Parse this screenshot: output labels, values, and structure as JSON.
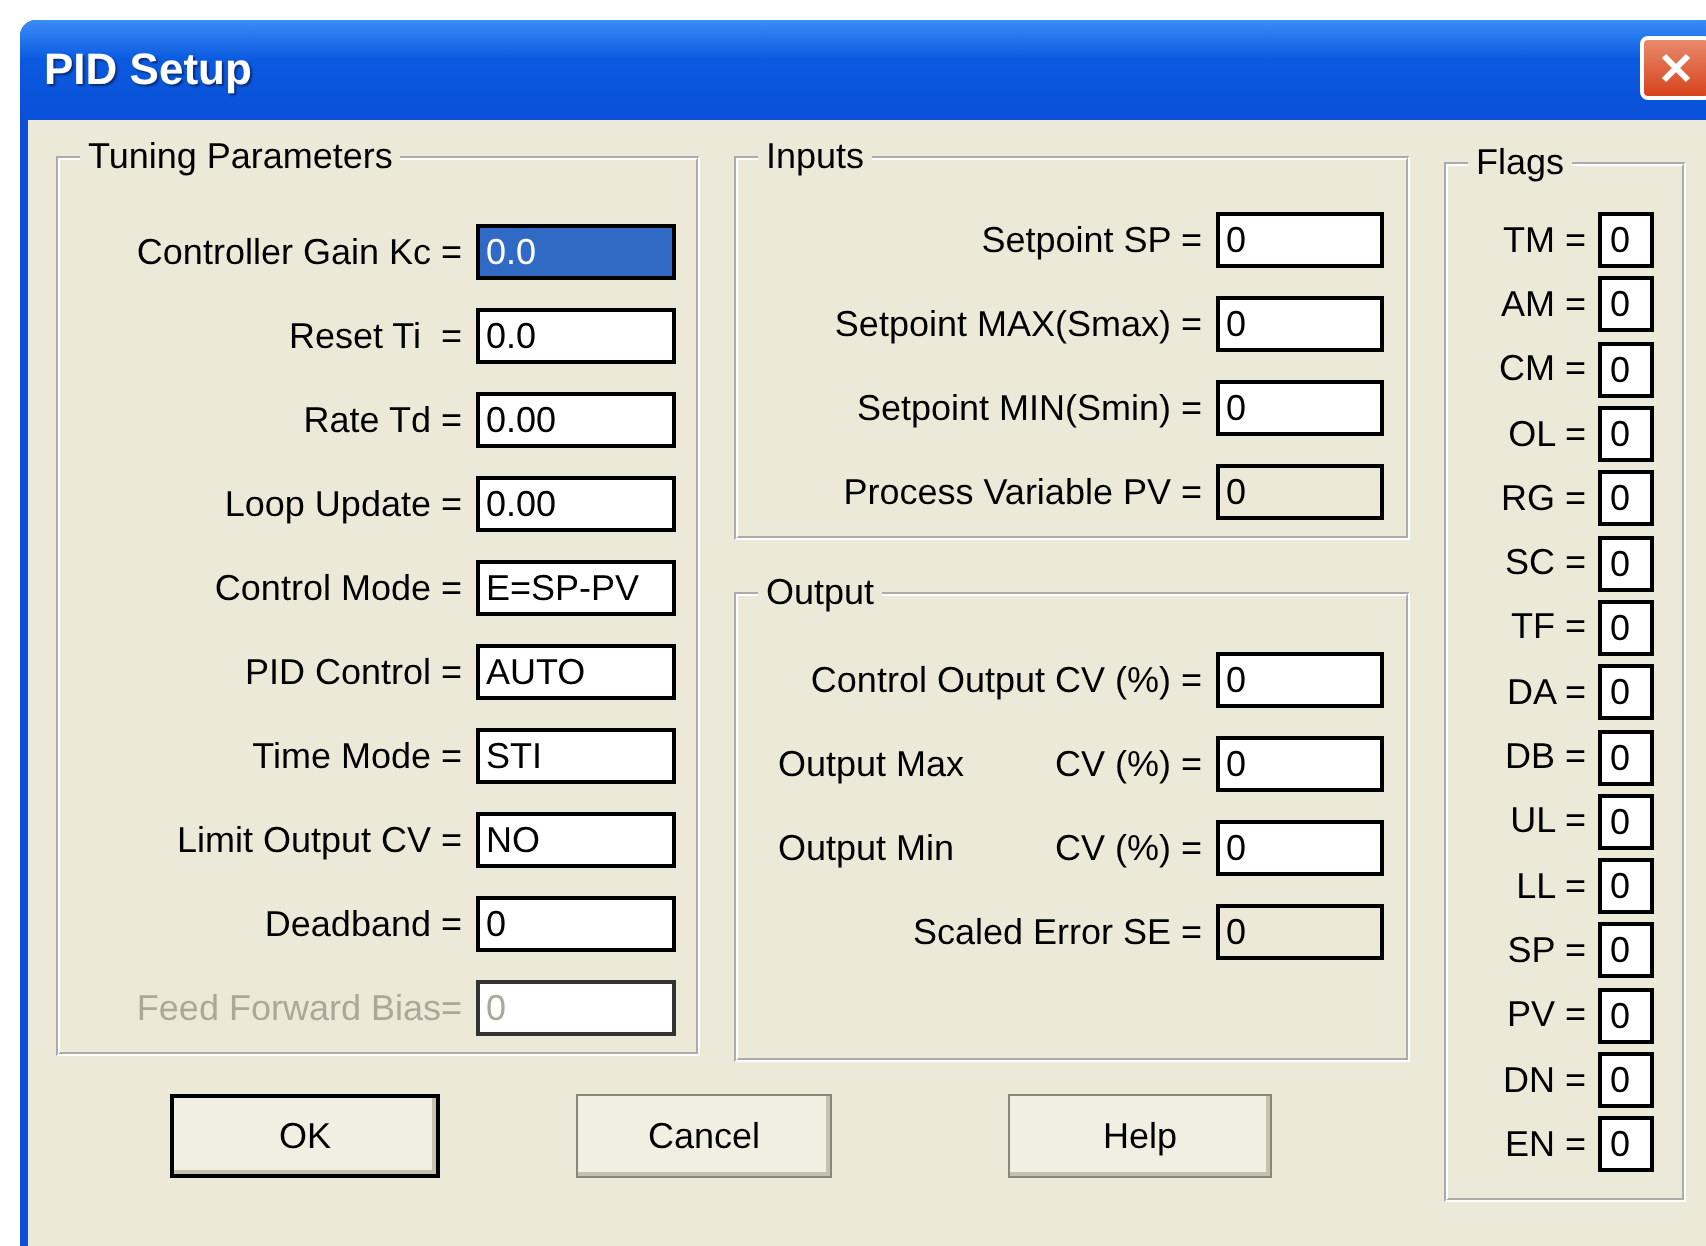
{
  "window": {
    "title": "PID Setup"
  },
  "tuning": {
    "title": "Tuning Parameters",
    "fields": [
      {
        "label": "Controller Gain Kc =",
        "value": "0.0",
        "selected": true,
        "disabled": false
      },
      {
        "label": "Reset Ti  =",
        "value": "0.0",
        "selected": false,
        "disabled": false
      },
      {
        "label": "Rate Td =",
        "value": "0.00",
        "selected": false,
        "disabled": false
      },
      {
        "label": "Loop Update =",
        "value": "0.00",
        "selected": false,
        "disabled": false
      },
      {
        "label": "Control Mode =",
        "value": "E=SP-PV",
        "selected": false,
        "disabled": false
      },
      {
        "label": "PID Control =",
        "value": "AUTO",
        "selected": false,
        "disabled": false
      },
      {
        "label": "Time Mode =",
        "value": "STI",
        "selected": false,
        "disabled": false
      },
      {
        "label": "Limit Output CV =",
        "value": "NO",
        "selected": false,
        "disabled": false
      },
      {
        "label": "Deadband =",
        "value": "0",
        "selected": false,
        "disabled": false
      },
      {
        "label": "Feed Forward Bias=",
        "value": "0",
        "selected": false,
        "disabled": true
      }
    ]
  },
  "inputs": {
    "title": "Inputs",
    "fields": [
      {
        "label": "Setpoint SP =",
        "value": "0",
        "read_only": false
      },
      {
        "label": "Setpoint MAX(Smax) =",
        "value": "0",
        "read_only": false
      },
      {
        "label": "Setpoint MIN(Smin) =",
        "value": "0",
        "read_only": false
      },
      {
        "label": "Process Variable PV =",
        "value": "0",
        "read_only": true
      }
    ]
  },
  "output": {
    "title": "Output",
    "fields": [
      {
        "label": "Control Output CV (%) =",
        "value": "0",
        "read_only": false
      },
      {
        "label": "Output Max",
        "unit_label": "CV (%) =",
        "value": "0",
        "read_only": false
      },
      {
        "label": "Output Min",
        "unit_label": "CV (%) =",
        "value": "0",
        "read_only": false
      },
      {
        "label": "Scaled Error SE =",
        "value": "0",
        "read_only": true
      }
    ]
  },
  "flags": {
    "title": "Flags",
    "fields": [
      {
        "label": "TM =",
        "value": "0"
      },
      {
        "label": "AM =",
        "value": "0"
      },
      {
        "label": "CM =",
        "value": "0"
      },
      {
        "label": "OL =",
        "value": "0"
      },
      {
        "label": "RG =",
        "value": "0"
      },
      {
        "label": "SC =",
        "value": "0"
      },
      {
        "label": "TF =",
        "value": "0"
      },
      {
        "label": "DA =",
        "value": "0"
      },
      {
        "label": "DB =",
        "value": "0"
      },
      {
        "label": "UL =",
        "value": "0"
      },
      {
        "label": "LL =",
        "value": "0"
      },
      {
        "label": "SP =",
        "value": "0"
      },
      {
        "label": "PV =",
        "value": "0"
      },
      {
        "label": "DN =",
        "value": "0"
      },
      {
        "label": "EN =",
        "value": "0"
      }
    ]
  },
  "buttons": [
    {
      "label": "OK",
      "default": true
    },
    {
      "label": "Cancel",
      "default": false
    },
    {
      "label": "Help",
      "default": false
    }
  ]
}
